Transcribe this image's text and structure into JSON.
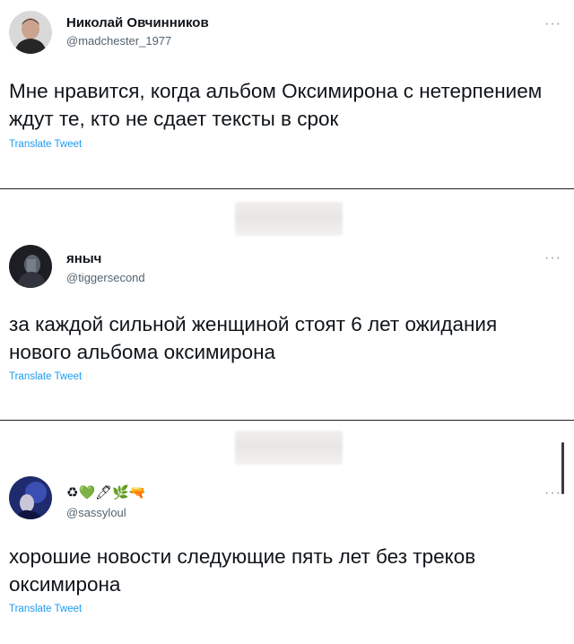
{
  "tweets": [
    {
      "name": "Николай Овчинников",
      "handle": "@madchester_1977",
      "text": "Мне нравится, когда альбом Оксимирона с нетерпением ждут те, кто не сдает тексты в срок",
      "translate": "Translate Tweet",
      "more": "···"
    },
    {
      "name": "яныч",
      "handle": "@tiggersecond",
      "text": "за каждой сильной женщиной стоят 6 лет ожидания нового альбома оксимирона",
      "translate": "Translate Tweet",
      "more": "···"
    },
    {
      "name": "♻💚🖊🌿🔫",
      "handle": "@sassyloul",
      "text": "хорошие новости следующие пять лет без треков оксимирона",
      "translate": "Translate Tweet",
      "more": "···"
    }
  ]
}
